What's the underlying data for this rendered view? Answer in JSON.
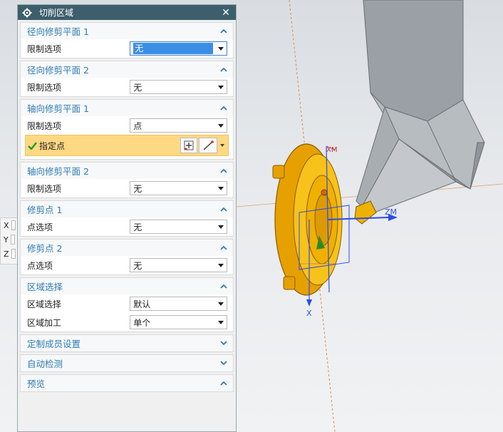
{
  "dialog": {
    "title": "切削区域",
    "close_label": "✕"
  },
  "groups": [
    {
      "title": "径向修剪平面 1",
      "rows": [
        {
          "label": "限制选项",
          "value": "无"
        }
      ]
    },
    {
      "title": "径向修剪平面 2",
      "rows": [
        {
          "label": "限制选项",
          "value": "无"
        }
      ]
    },
    {
      "title": "轴向修剪平面 1",
      "rows": [
        {
          "label": "限制选项",
          "value": "点"
        }
      ],
      "point_label": "指定点"
    },
    {
      "title": "轴向修剪平面 2",
      "rows": [
        {
          "label": "限制选项",
          "value": "无"
        }
      ]
    },
    {
      "title": "修剪点 1",
      "rows": [
        {
          "label": "点选项",
          "value": "无"
        }
      ]
    },
    {
      "title": "修剪点 2",
      "rows": [
        {
          "label": "点选项",
          "value": "无"
        }
      ]
    },
    {
      "title": "区域选择",
      "rows": [
        {
          "label": "区域选择",
          "value": "默认"
        },
        {
          "label": "区域加工",
          "value": "单个"
        }
      ]
    },
    {
      "title": "定制成员设置"
    },
    {
      "title": "自动检测"
    },
    {
      "title": "预览"
    }
  ],
  "coords": {
    "x_label": "X",
    "y_label": "Y",
    "z_label": "Z"
  },
  "viewport": {
    "axis_labels": {
      "zm": "ZM",
      "xm": "XM",
      "x": "X"
    }
  },
  "colors": {
    "titlebar": "#3d5f6c",
    "section_title": "#2e7cb3",
    "highlight_row": "#ffd884",
    "part_orange": "#f5b400",
    "axis_blue": "#1f3de0"
  },
  "icons": {
    "title": "gear-icon",
    "close": "close-icon",
    "expand": "chevron-up-icon",
    "collapse": "chevron-down-icon",
    "point_ok": "check-icon",
    "point_dialog": "point-dialog-icon",
    "inferred_point": "inferred-point-icon"
  }
}
